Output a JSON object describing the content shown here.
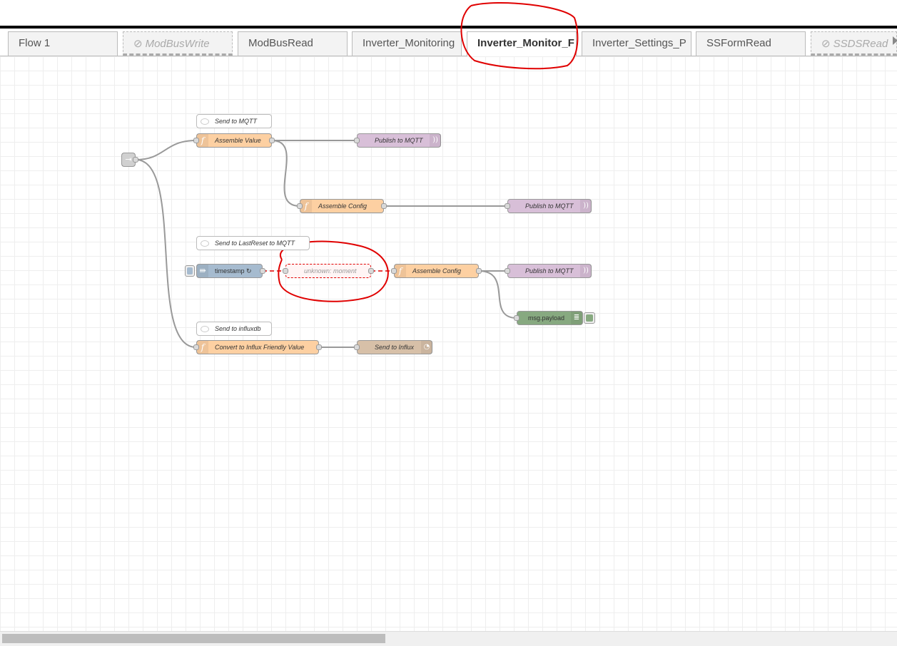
{
  "tabs": [
    {
      "label": "Flow 1",
      "disabled": false,
      "active": false
    },
    {
      "label": "ModBusWrite",
      "disabled": true,
      "active": false
    },
    {
      "label": "ModBusRead",
      "disabled": false,
      "active": false
    },
    {
      "label": "Inverter_Monitoring",
      "disabled": false,
      "active": false
    },
    {
      "label": "Inverter_Monitor_F",
      "disabled": false,
      "active": true
    },
    {
      "label": "Inverter_Settings_P",
      "disabled": false,
      "active": false
    },
    {
      "label": "SSFormRead",
      "disabled": false,
      "active": false
    },
    {
      "label": "SSDSRead",
      "disabled": true,
      "active": false
    }
  ],
  "comments": {
    "send_mqtt": "Send to MQTT",
    "send_lastreset": "Send to LastReset to MQTT",
    "send_influx": "Send to influxdb"
  },
  "nodes": {
    "assemble_value": "Assemble Value",
    "publish_mqtt_1": "Publish to MQTT",
    "assemble_config_1": "Assemble Config",
    "publish_mqtt_2": "Publish to MQTT",
    "timestamp": "timestamp ↻",
    "unknown_moment": "unknown: moment",
    "assemble_config_2": "Assemble Config",
    "publish_mqtt_3": "Publish to MQTT",
    "msg_payload": "msg.payload",
    "convert_influx": "Convert to Influx Friendly Value",
    "send_influx": "Send to Influx"
  },
  "colors": {
    "function": "#fdd0a2",
    "mqtt": "#d8bfd8",
    "inject": "#a6bbcf",
    "debug": "#87a980",
    "influx": "#d7c0a8",
    "annotation": "#e00000",
    "wire": "#999999"
  }
}
